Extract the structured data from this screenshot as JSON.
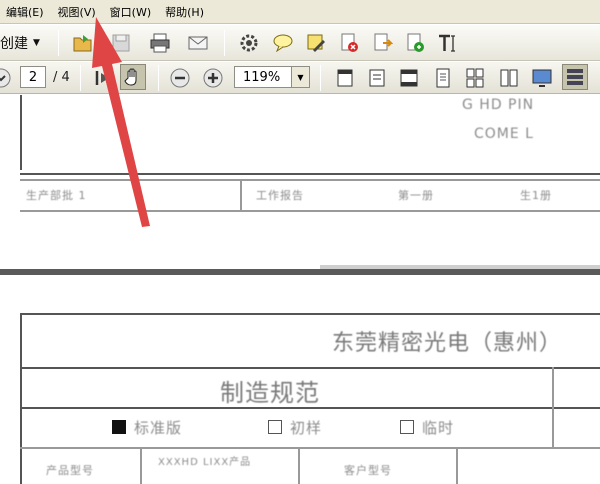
{
  "menubar": {
    "items": [
      "编辑(E)",
      "视图(V)",
      "窗口(W)",
      "帮助(H)"
    ]
  },
  "toolbar": {
    "create_label": "创建"
  },
  "navigation": {
    "current_page": "2",
    "total_pages": "/ 4"
  },
  "zoom": {
    "value": "119%"
  },
  "document": {
    "page1_lines": [
      "G HD PIN",
      "COME L"
    ],
    "page1_row": [
      "生产部批 1",
      "工作报告",
      "第一册",
      "生1册"
    ],
    "page2_title": "东莞精密光电（惠州）",
    "page2_subtitle": "制造规范",
    "page2_checks": [
      "标准版",
      "初样",
      "临时"
    ],
    "page2_row": [
      "产品型号",
      "XXXHD LIXX产品",
      "客户型号"
    ]
  },
  "colors": {
    "arrow": "#e04545",
    "menubar_bg": "#ece9d8"
  }
}
